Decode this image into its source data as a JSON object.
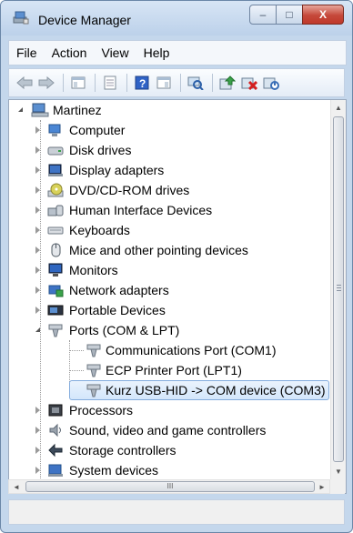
{
  "window": {
    "title": "Device Manager",
    "icon": "device-manager-icon"
  },
  "caption_buttons": {
    "minimize": "–",
    "maximize": "□",
    "close": "X"
  },
  "menu": [
    "File",
    "Action",
    "View",
    "Help"
  ],
  "toolbar": [
    "back-icon",
    "forward-icon",
    "show-hide-console-tree-icon",
    "properties-icon",
    "help-icon",
    "action-pane-icon",
    "scan-hardware-icon",
    "update-driver-icon",
    "uninstall-icon",
    "disable-icon"
  ],
  "tree": {
    "root": "Martinez",
    "items": [
      {
        "label": "Computer",
        "icon": "computer-icon",
        "state": "collapsed"
      },
      {
        "label": "Disk drives",
        "icon": "disk-drive-icon",
        "state": "collapsed"
      },
      {
        "label": "Display adapters",
        "icon": "display-adapter-icon",
        "state": "collapsed"
      },
      {
        "label": "DVD/CD-ROM drives",
        "icon": "dvd-drive-icon",
        "state": "collapsed"
      },
      {
        "label": "Human Interface Devices",
        "icon": "hid-icon",
        "state": "collapsed"
      },
      {
        "label": "Keyboards",
        "icon": "keyboard-icon",
        "state": "collapsed"
      },
      {
        "label": "Mice and other pointing devices",
        "icon": "mouse-icon",
        "state": "collapsed"
      },
      {
        "label": "Monitors",
        "icon": "monitor-icon",
        "state": "collapsed"
      },
      {
        "label": "Network adapters",
        "icon": "network-adapter-icon",
        "state": "collapsed"
      },
      {
        "label": "Portable Devices",
        "icon": "portable-device-icon",
        "state": "collapsed"
      },
      {
        "label": "Ports (COM & LPT)",
        "icon": "port-icon",
        "state": "expanded",
        "children": [
          {
            "label": "Communications Port (COM1)",
            "icon": "port-icon"
          },
          {
            "label": "ECP Printer Port (LPT1)",
            "icon": "port-icon"
          },
          {
            "label": "Kurz USB-HID -> COM device (COM3)",
            "icon": "port-icon",
            "selected": true
          }
        ]
      },
      {
        "label": "Processors",
        "icon": "processor-icon",
        "state": "collapsed"
      },
      {
        "label": "Sound, video and game controllers",
        "icon": "sound-icon",
        "state": "collapsed"
      },
      {
        "label": "Storage controllers",
        "icon": "storage-controller-icon",
        "state": "collapsed"
      },
      {
        "label": "System devices",
        "icon": "system-device-icon",
        "state": "collapsed"
      }
    ]
  },
  "scrollbar": {
    "horizontal_thumb_grip": "III",
    "up": "▲",
    "down": "▼",
    "left": "◄",
    "right": "►"
  }
}
